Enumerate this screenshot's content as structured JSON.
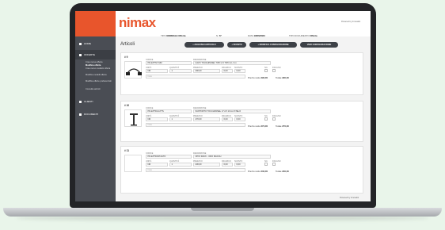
{
  "app": {
    "logo": "nimax",
    "powered_by": "Powered by Innovabit"
  },
  "sidebar": {
    "items": [
      {
        "label": "HOME",
        "icon": "home-icon"
      },
      {
        "label": "OFFERTE",
        "icon": "offer-icon"
      },
      {
        "label": "CLIENTI",
        "icon": "clients-icon"
      },
      {
        "label": "DOCUMENTI",
        "icon": "docs-icon"
      }
    ],
    "sub_items": [
      "Crea nuova offerta",
      "Modifica offerta",
      "Crea nuovo modello offerta",
      "Modifica modelli offerta",
      "Modifica offerte preferenziali",
      "Consulta articoli"
    ]
  },
  "topbar": {
    "tipo_label": "TIPO",
    "tipo_value": "NORMALE  Offerta",
    "n_label": "N.",
    "n_value": "77",
    "data_label": "DATA",
    "data_value": "18/06/2023",
    "tipo_doc_label": "TIPO DOCUMENTO",
    "tipo_doc_value": "Offerta"
  },
  "main": {
    "title": "Articoli",
    "buttons": [
      "+ AGGIUNGI ARTICOLO",
      "+ SCONTO",
      "+ MODIFICA CONFIGURAZIONE",
      "VEDI CONFIGURAZIONE"
    ]
  },
  "labels": {
    "codice": "CODICE",
    "descrizione": "DESCRIZIONE",
    "unita": "UNITÀ",
    "quantita": "QUANTITÀ",
    "prezzo": "PREZZO €",
    "ricarico": "RICARICO",
    "sconto": "SCONTO",
    "iva": "IVA",
    "incluso": "INCLUSO",
    "note_placeholder": "Note",
    "prezzo_netto": "Prezzo netto",
    "totale": "Totale"
  },
  "articles": [
    {
      "no": "# 9",
      "codice": "PR-EPTN7-MM",
      "descrizione": "CAVO TOUCHPANEL TIPO 2.0 TIPO A L 3 m",
      "unita": "NR",
      "quantita": "1",
      "prezzo": "290,00",
      "ricarico": "0,00",
      "sconto": "0,00",
      "netto": "290,00",
      "totale": "290,00"
    },
    {
      "no": "# 10",
      "codice": "PR-EPTD14-PTS",
      "descrizione": "SUPPORTO TOUCHPANEL 17 A 5 10 A A STELO",
      "unita": "NR",
      "quantita": "1",
      "prezzo": "270,00",
      "ricarico": "0,00",
      "sconto": "0,00",
      "netto": "270,00",
      "totale": "270,00"
    },
    {
      "no": "# 11",
      "codice": "PR-EPTD2STAATO",
      "descrizione": "OPIO RACK - ORO MACCH",
      "unita": "NR",
      "quantita": "1",
      "prezzo": "230,00",
      "ricarico": "0,00",
      "sconto": "0,00",
      "netto": "230,00",
      "totale": "230,00"
    }
  ]
}
